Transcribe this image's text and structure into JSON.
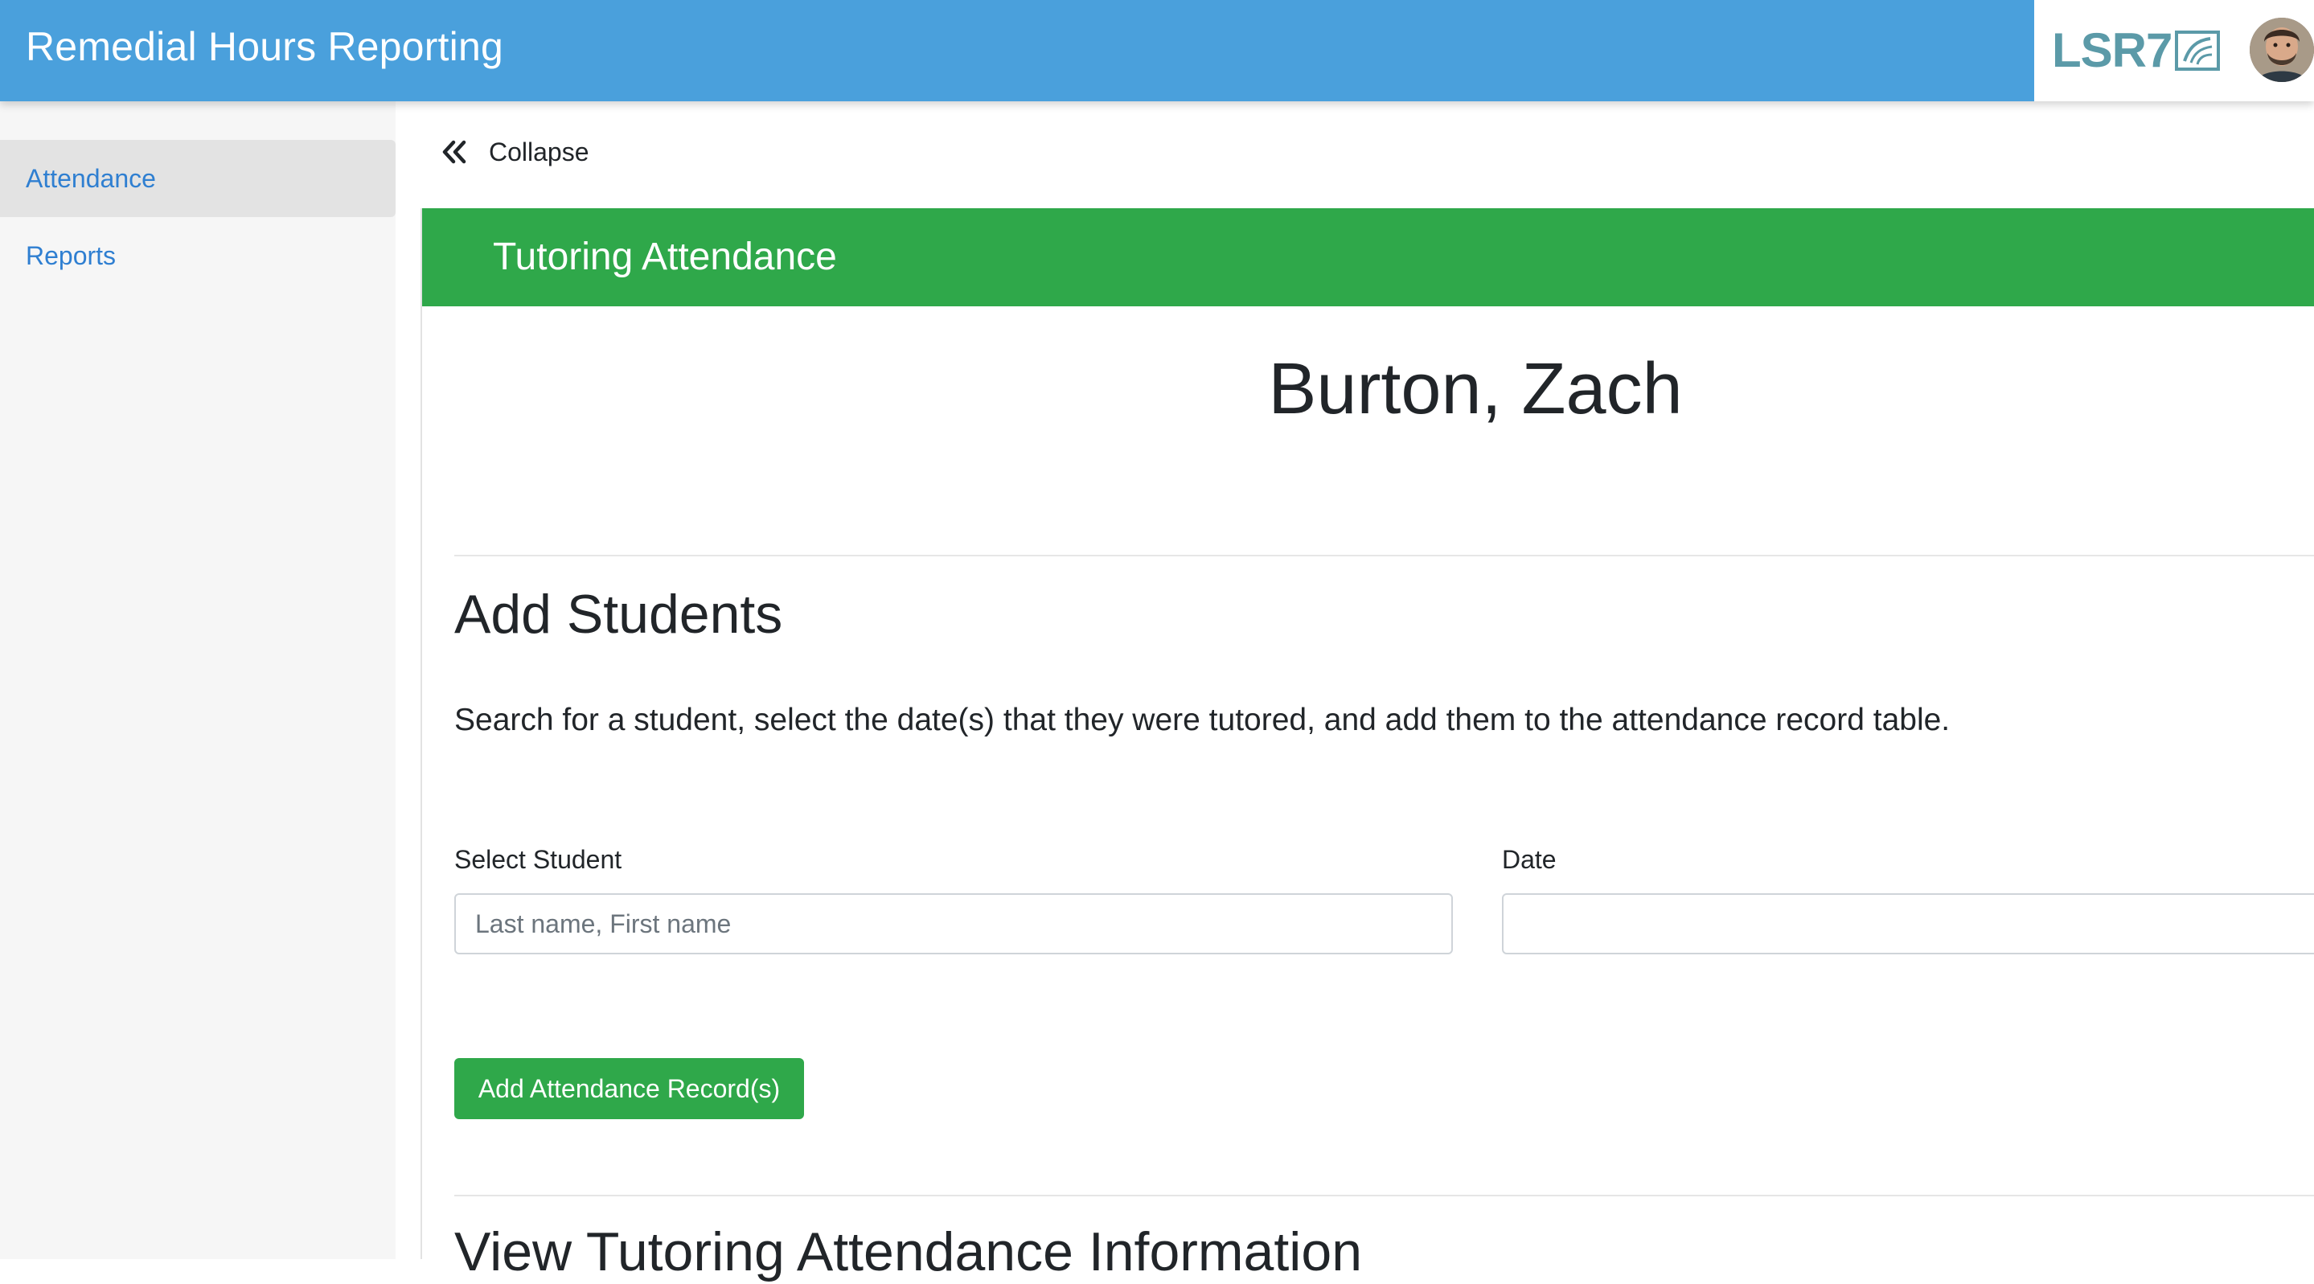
{
  "header": {
    "app_title": "Remedial Hours Reporting",
    "logo_text": "LSR7",
    "avatar_icon": "user-avatar-photo"
  },
  "sidebar": {
    "items": [
      {
        "label": "Attendance",
        "active": true
      },
      {
        "label": "Reports",
        "active": false
      }
    ]
  },
  "toolbar": {
    "collapse_label": "Collapse",
    "collapse_icon": "double-chevron-left-icon"
  },
  "card": {
    "title": "Tutoring Attendance",
    "tutor_name": "Burton, Zach"
  },
  "add_students": {
    "heading": "Add Students",
    "instructions": "Search for a student, select the date(s) that they were tutored, and add them to the attendance record table.",
    "student_label": "Select Student",
    "student_placeholder": "Last name, First name",
    "student_value": "",
    "date_label": "Date",
    "date_value": "",
    "add_button_label": "Add Attendance Record(s)"
  },
  "view_section": {
    "heading": "View Tutoring Attendance Information"
  },
  "colors": {
    "header_blue": "#4aa0dc",
    "success_green": "#2fa84a",
    "link_blue": "#2f7fd1",
    "logo_teal": "#5b9aa8"
  }
}
